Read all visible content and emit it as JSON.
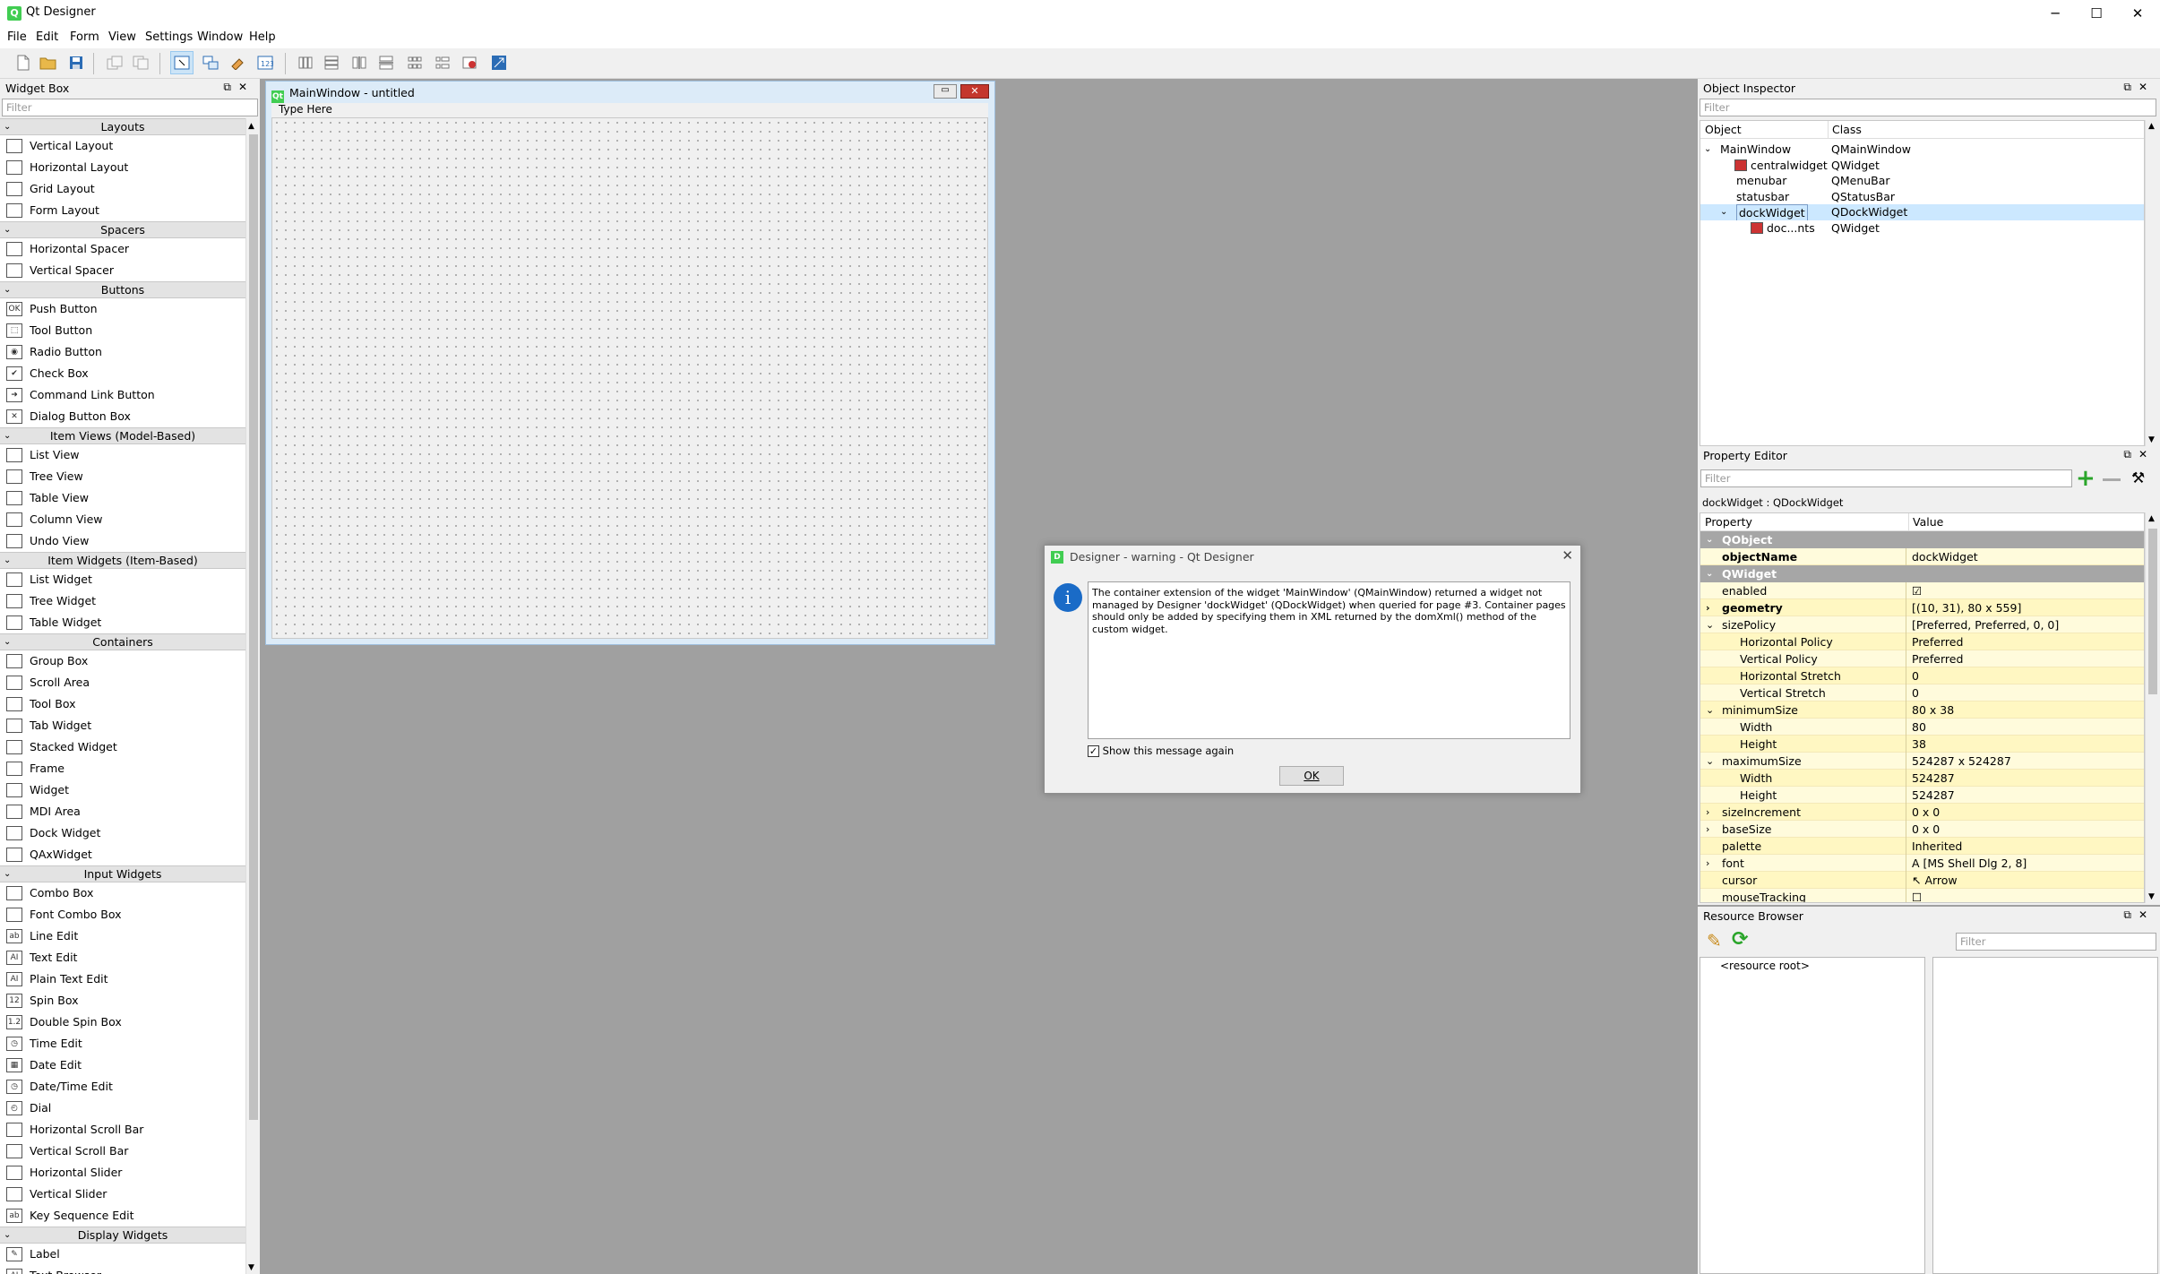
{
  "window": {
    "title": "Qt Designer",
    "app_icon": "Q",
    "minimize": "─",
    "maximize": "☐",
    "close": "✕"
  },
  "menu": [
    "File",
    "Edit",
    "Form",
    "View",
    "Settings",
    "Window",
    "Help"
  ],
  "widget_box": {
    "title": "Widget Box",
    "filter_placeholder": "Filter",
    "sections": [
      {
        "name": "Layouts",
        "items": [
          "Vertical Layout",
          "Horizontal Layout",
          "Grid Layout",
          "Form Layout"
        ]
      },
      {
        "name": "Spacers",
        "items": [
          "Horizontal Spacer",
          "Vertical Spacer"
        ]
      },
      {
        "name": "Buttons",
        "items": [
          "Push Button",
          "Tool Button",
          "Radio Button",
          "Check Box",
          "Command Link Button",
          "Dialog Button Box"
        ]
      },
      {
        "name": "Item Views (Model-Based)",
        "items": [
          "List View",
          "Tree View",
          "Table View",
          "Column View",
          "Undo View"
        ]
      },
      {
        "name": "Item Widgets (Item-Based)",
        "items": [
          "List Widget",
          "Tree Widget",
          "Table Widget"
        ]
      },
      {
        "name": "Containers",
        "items": [
          "Group Box",
          "Scroll Area",
          "Tool Box",
          "Tab Widget",
          "Stacked Widget",
          "Frame",
          "Widget",
          "MDI Area",
          "Dock Widget",
          "QAxWidget"
        ]
      },
      {
        "name": "Input Widgets",
        "items": [
          "Combo Box",
          "Font Combo Box",
          "Line Edit",
          "Text Edit",
          "Plain Text Edit",
          "Spin Box",
          "Double Spin Box",
          "Time Edit",
          "Date Edit",
          "Date/Time Edit",
          "Dial",
          "Horizontal Scroll Bar",
          "Vertical Scroll Bar",
          "Horizontal Slider",
          "Vertical Slider",
          "Key Sequence Edit"
        ]
      },
      {
        "name": "Display Widgets",
        "items": [
          "Label",
          "Text Browser"
        ]
      }
    ]
  },
  "form_window": {
    "title": "MainWindow - untitled",
    "type_here": "Type Here"
  },
  "object_inspector": {
    "title": "Object Inspector",
    "filter_placeholder": "Filter",
    "col_object": "Object",
    "col_class": "Class",
    "rows": [
      {
        "object": "MainWindow",
        "class": "QMainWindow",
        "indent": 0,
        "expander": "⌄"
      },
      {
        "object": "centralwidget",
        "class": "QWidget",
        "indent": 1,
        "expander": ""
      },
      {
        "object": "menubar",
        "class": "QMenuBar",
        "indent": 1,
        "expander": ""
      },
      {
        "object": "statusbar",
        "class": "QStatusBar",
        "indent": 1,
        "expander": ""
      },
      {
        "object": "dockWidget",
        "class": "QDockWidget",
        "indent": 1,
        "expander": "⌄",
        "selected": true
      },
      {
        "object": "doc...nts",
        "class": "QWidget",
        "indent": 2,
        "expander": ""
      }
    ]
  },
  "property_editor": {
    "title": "Property Editor",
    "filter_placeholder": "Filter",
    "context": "dockWidget : QDockWidget",
    "col_property": "Property",
    "col_value": "Value",
    "rows": [
      {
        "type": "cat",
        "key": "QObject"
      },
      {
        "type": "prop",
        "key": "objectName",
        "value": "dockWidget",
        "bold": true,
        "level": 0
      },
      {
        "type": "cat",
        "key": "QWidget"
      },
      {
        "type": "prop",
        "key": "enabled",
        "value": "☑",
        "level": 0
      },
      {
        "type": "prop",
        "key": "geometry",
        "value": "[(10, 31), 80 x 559]",
        "bold": true,
        "level": 0,
        "exp": "›"
      },
      {
        "type": "prop",
        "key": "sizePolicy",
        "value": "[Preferred, Preferred, 0, 0]",
        "level": 0,
        "exp": "⌄"
      },
      {
        "type": "prop",
        "key": "Horizontal Policy",
        "value": "Preferred",
        "level": 1
      },
      {
        "type": "prop",
        "key": "Vertical Policy",
        "value": "Preferred",
        "level": 1
      },
      {
        "type": "prop",
        "key": "Horizontal Stretch",
        "value": "0",
        "level": 1
      },
      {
        "type": "prop",
        "key": "Vertical Stretch",
        "value": "0",
        "level": 1
      },
      {
        "type": "prop",
        "key": "minimumSize",
        "value": "80 x 38",
        "level": 0,
        "exp": "⌄"
      },
      {
        "type": "prop",
        "key": "Width",
        "value": "80",
        "level": 1
      },
      {
        "type": "prop",
        "key": "Height",
        "value": "38",
        "level": 1
      },
      {
        "type": "prop",
        "key": "maximumSize",
        "value": "524287 x 524287",
        "level": 0,
        "exp": "⌄"
      },
      {
        "type": "prop",
        "key": "Width",
        "value": "524287",
        "level": 1
      },
      {
        "type": "prop",
        "key": "Height",
        "value": "524287",
        "level": 1
      },
      {
        "type": "prop",
        "key": "sizeIncrement",
        "value": "0 x 0",
        "level": 0,
        "exp": "›"
      },
      {
        "type": "prop",
        "key": "baseSize",
        "value": "0 x 0",
        "level": 0,
        "exp": "›"
      },
      {
        "type": "prop",
        "key": "palette",
        "value": "Inherited",
        "level": 0
      },
      {
        "type": "prop",
        "key": "font",
        "value": "A  [MS Shell Dlg 2, 8]",
        "level": 0,
        "exp": "›"
      },
      {
        "type": "prop",
        "key": "cursor",
        "value": "↖  Arrow",
        "level": 0
      },
      {
        "type": "prop",
        "key": "mouseTracking",
        "value": "☐",
        "level": 0
      }
    ]
  },
  "resource_browser": {
    "title": "Resource Browser",
    "filter_placeholder": "Filter",
    "root": "<resource root>"
  },
  "dialog": {
    "title": "Designer - warning - Qt Designer",
    "message": "The container extension of the widget 'MainWindow' (QMainWindow) returned a widget not managed by Designer 'dockWidget' (QDockWidget) when queried for page #3. Container pages should only be added by specifying them in XML returned by the domXml() method of the custom widget.",
    "checkbox_label": "Show this message again",
    "checkbox_checked": true,
    "ok_label": "OK"
  }
}
